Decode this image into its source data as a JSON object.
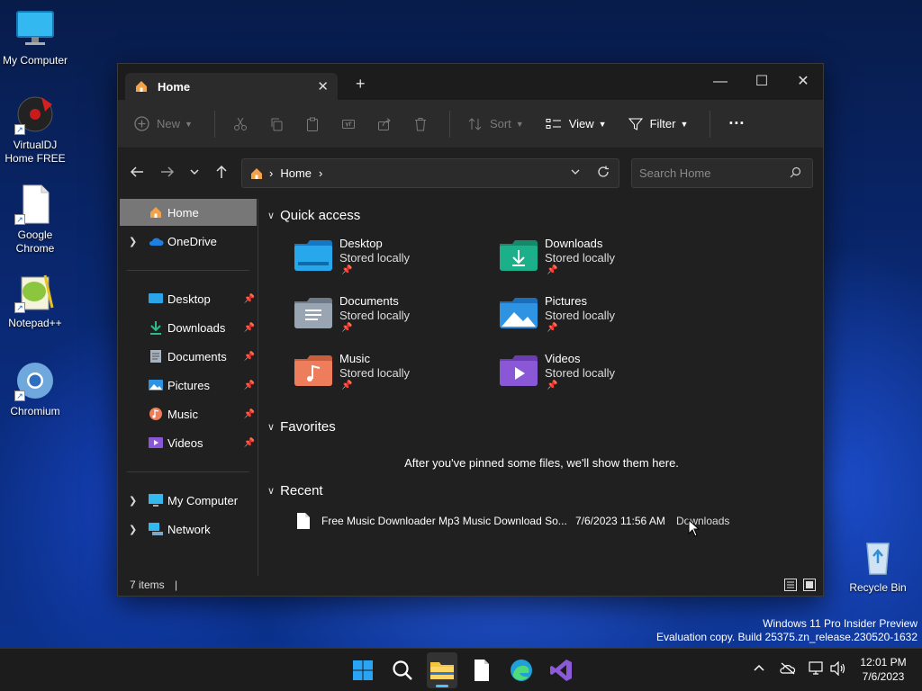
{
  "desktop": {
    "icons": [
      {
        "label": "My Computer",
        "icon": "monitor-icon"
      },
      {
        "label": "VirtualDJ Home FREE",
        "icon": "virtualdj-icon"
      },
      {
        "label": "Google Chrome",
        "icon": "blank-file-icon"
      },
      {
        "label": "Notepad++",
        "icon": "notepadpp-icon"
      },
      {
        "label": "Chromium",
        "icon": "chromium-icon"
      },
      {
        "label": "Recycle Bin",
        "icon": "recycle-bin-icon"
      }
    ],
    "watermark_line1": "Windows 11 Pro Insider Preview",
    "watermark_line2": "Evaluation copy. Build 25375.zn_release.230520-1632"
  },
  "window": {
    "tab_title": "Home",
    "tab_close": "✕",
    "new_tab": "+",
    "controls": {
      "minimize": "—",
      "maximize": "☐",
      "close": "✕"
    },
    "toolbar": {
      "new_label": "New",
      "sort_label": "Sort",
      "view_label": "View",
      "filter_label": "Filter",
      "more_label": "···"
    },
    "address": {
      "crumb": "Home",
      "search_placeholder": "Search Home"
    },
    "nav": {
      "home": "Home",
      "onedrive": "OneDrive",
      "pinned": [
        "Desktop",
        "Downloads",
        "Documents",
        "Pictures",
        "Music",
        "Videos"
      ],
      "mycomputer": "My Computer",
      "network": "Network"
    },
    "content": {
      "quick_access_title": "Quick access",
      "quick_access": [
        {
          "name": "Desktop",
          "status": "Stored locally",
          "color": "#1e9be0"
        },
        {
          "name": "Downloads",
          "status": "Stored locally",
          "color": "#1bb08a"
        },
        {
          "name": "Documents",
          "status": "Stored locally",
          "color": "#8f9aa8"
        },
        {
          "name": "Pictures",
          "status": "Stored locally",
          "color": "#2f93e4"
        },
        {
          "name": "Music",
          "status": "Stored locally",
          "color": "#ee7d5b"
        },
        {
          "name": "Videos",
          "status": "Stored locally",
          "color": "#8a57d6"
        }
      ],
      "favorites_title": "Favorites",
      "favorites_empty": "After you've pinned some files, we'll show them here.",
      "recent_title": "Recent",
      "recent": [
        {
          "name": "Free Music Downloader Mp3 Music Download So...",
          "date": "7/6/2023 11:56 AM",
          "location": "Downloads"
        }
      ]
    },
    "status": {
      "items": "7 items"
    }
  },
  "taskbar": {
    "time": "12:01 PM",
    "date": "7/6/2023"
  }
}
